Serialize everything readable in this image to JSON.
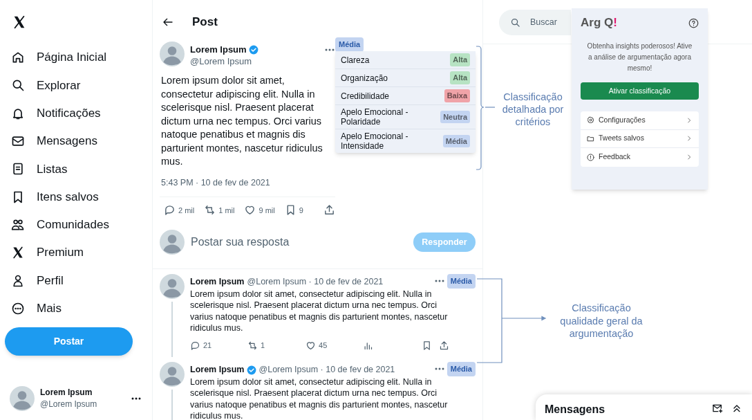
{
  "sidebar": {
    "nav_items": [
      {
        "kind": "home",
        "label": "Página Inicial"
      },
      {
        "kind": "search",
        "label": "Explorar"
      },
      {
        "kind": "bell",
        "label": "Notificações"
      },
      {
        "kind": "mail",
        "label": "Mensagens"
      },
      {
        "kind": "list",
        "label": "Listas"
      },
      {
        "kind": "bookmark",
        "label": "Itens salvos"
      },
      {
        "kind": "people",
        "label": "Comunidades"
      },
      {
        "kind": "x",
        "label": "Premium"
      },
      {
        "kind": "person",
        "label": "Perfil"
      },
      {
        "kind": "more",
        "label": "Mais"
      }
    ],
    "post_button": "Postar",
    "account": {
      "name": "Lorem Ipsum",
      "handle": "@Lorem Ipsum"
    }
  },
  "main": {
    "header": "Post",
    "post": {
      "name": "Lorem Ipsum",
      "verified": true,
      "handle": "@Lorem Ipsum",
      "text": "Lorem ipsum dolor sit amet, consectetur adipiscing elit. Nulla in scelerisque nisl. Praesent placerat dictum urna nec tempus. Orci varius natoque penatibus et magnis dis parturient montes, nascetur ridiculus mus.",
      "timestamp": "5:43 PM · 10 de fev de 2021",
      "rating": "Média",
      "actions": [
        {
          "kind": "reply",
          "count": "2 mil"
        },
        {
          "kind": "repost",
          "count": "1 mil"
        },
        {
          "kind": "like",
          "count": "9 mil"
        },
        {
          "kind": "bookmark",
          "count": "9"
        },
        {
          "kind": "share"
        }
      ]
    },
    "criteria": [
      {
        "label": "Clareza",
        "value": "Alta",
        "color": "#b7e3c3"
      },
      {
        "label": "Organização",
        "value": "Alta",
        "color": "#b7e3c3"
      },
      {
        "label": "Credibilidade",
        "value": "Baixa",
        "color": "#f0a3a8"
      },
      {
        "label": "Apelo Emocional - Polaridade",
        "value": "Neutra",
        "color": "#c3d4f1"
      },
      {
        "label": "Apelo Emocional - Intensidade",
        "value": "Média",
        "color": "#c3d4f1"
      }
    ],
    "reply_box": {
      "placeholder": "Postar sua resposta",
      "button": "Responder"
    },
    "replies": [
      {
        "name": "Lorem Ipsum",
        "verified": false,
        "handle": "@Lorem Ipsum · 10 de fev de 2021",
        "text": "Lorem ipsum dolor sit amet, consectetur adipiscing elit. Nulla in scelerisque nisl. Praesent placerat dictum urna nec tempus. Orci varius natoque penatibus et magnis dis parturient montes, nascetur ridiculus mus.",
        "rating": "Média",
        "actions": [
          {
            "kind": "reply",
            "count": "21"
          },
          {
            "kind": "repost",
            "count": "1"
          },
          {
            "kind": "like",
            "count": "45"
          },
          {
            "kind": "views"
          },
          {
            "kind": "bookmark"
          },
          {
            "kind": "share"
          }
        ]
      },
      {
        "name": "Lorem Ipsum",
        "verified": true,
        "handle": "@Lorem Ipsum · 10 de fev de 2021",
        "text": "Lorem ipsum dolor sit amet, consectetur adipiscing elit. Nulla in scelerisque nisl. Praesent placerat dictum urna nec tempus. Orci varius natoque penatibus et magnis dis parturient montes, nascetur ridiculus mus.",
        "rating": "Média"
      }
    ]
  },
  "search": {
    "placeholder": "Buscar"
  },
  "extension": {
    "logo": "Arg Q",
    "logo_mark": "!",
    "message": "Obtenha insights poderosos! Ative a análise de argumentação agora mesmo!",
    "button": "Ativar classificação",
    "menu": [
      {
        "kind": "settings",
        "label": "Configurações"
      },
      {
        "kind": "folder",
        "label": "Tweets salvos"
      },
      {
        "kind": "info",
        "label": "Feedback"
      }
    ]
  },
  "annotations": [
    "Classificação detalhada por critérios",
    "Classificação qualidade geral da argumentação"
  ],
  "messages_dock": {
    "title": "Mensagens"
  }
}
